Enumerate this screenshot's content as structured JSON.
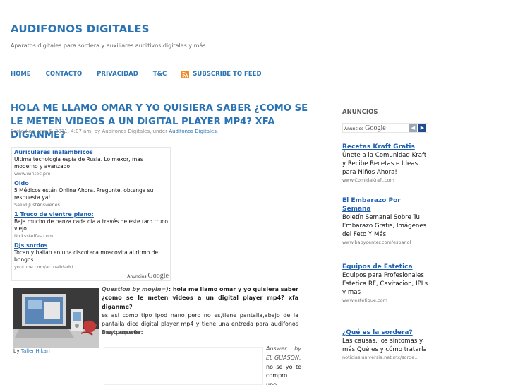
{
  "site": {
    "title": "AUDIFONOS DIGITALES",
    "description": "Aparatos digitales para sordera y auxiliares auditivos digitales y más"
  },
  "nav": {
    "items": [
      "HOME",
      "CONTACTO",
      "PRIVACIDAD",
      "T&C"
    ],
    "subscribe": "SUBSCRIBE TO FEED",
    "subscribe_icon": "rss-icon"
  },
  "post": {
    "title": "HOLA ME LLAMO OMAR Y YO QUISIERA SABER ¿COMO SE LE METEN VIDEOS A UN DIGITAL PLAYER MP4? XFA DIGANME?",
    "meta_prefix": "Posted on June 6, 2011, 4:07 am, by Audifonos Digitales, under",
    "meta_category": "Audifonos Digitales",
    "meta_suffix": "."
  },
  "inline_ads": {
    "items": [
      {
        "title": "Auriculares inalambricos",
        "desc": "Ultima tecnologia espía de Rusia. Lo mexor, mas moderno y avanzado!",
        "url": "www.wintec.pro"
      },
      {
        "title": "Oido",
        "desc": "5 Médicos están Online Ahora. Pregunte, obtenga su respuesta ya!",
        "url": "Salud.JustAnswer.es"
      },
      {
        "title": "1 Truco de vientre plano:",
        "desc": "Baja mucho de panza cada dia a través de este raro truco viejo.",
        "url": "Nickssteffes.com"
      },
      {
        "title": "DJs sordos",
        "desc": "Tocan y bailan en una discoteca moscovita al ritmo de bongos.",
        "url": "youtube.com/actualidadrt"
      }
    ],
    "brand_label": "Anuncios",
    "brand_name": "Google"
  },
  "photo": {
    "credit_prefix": "by",
    "credit_name": "Taller Hikari"
  },
  "question": {
    "by_label": "Question by moyin=)",
    "title": ": hola me llamo omar y yo quisiera saber ¿como se le meten videos a un digital player mp4? xfa diganme?",
    "body": "es asi como tipo ipod nano pero no es,tiene pantalla,abajo de la pantalla dice digital player mp4 y tiene una entreda para audifonos muy pequeña"
  },
  "best_answer": {
    "label": "Best answer:",
    "by_label": "Answer by EL GUASON.",
    "body": "no se yo te compro uno."
  },
  "sidebar": {
    "heading": "ANUNCIOS",
    "brand_label": "Anuncios",
    "brand_name": "Google",
    "prev_icon": "chevron-left-icon",
    "next_icon": "chevron-right-icon",
    "ads": [
      {
        "title": "Recetas Kraft Gratis",
        "desc": "Únete a la Comunidad Kraft y Recibe Recetas e Ideas para Niños Ahora!",
        "url": "www.ComidaKraft.com"
      },
      {
        "title": "El Embarazo Por Semana",
        "desc": "Boletín Semanal Sobre Tu Embarazo Gratis, Imágenes del Feto Y Más.",
        "url": "www.babycenter.com/espanol"
      },
      {
        "title": "Equipos de Estetica",
        "desc": "Equipos para Profesionales Estetica RF, Cavitacion, IPLs y mas",
        "url": "www.estetique.com"
      },
      {
        "title": "¿Qué es la sordera?",
        "desc": "Las causas, los síntomas y más Qué es y cómo tratarla",
        "url": "noticias.universia.net.mx/sorde..."
      }
    ]
  },
  "colors": {
    "accent": "#2a74b5",
    "ad_link": "#1e5fb0",
    "rss": "#f0891f"
  }
}
